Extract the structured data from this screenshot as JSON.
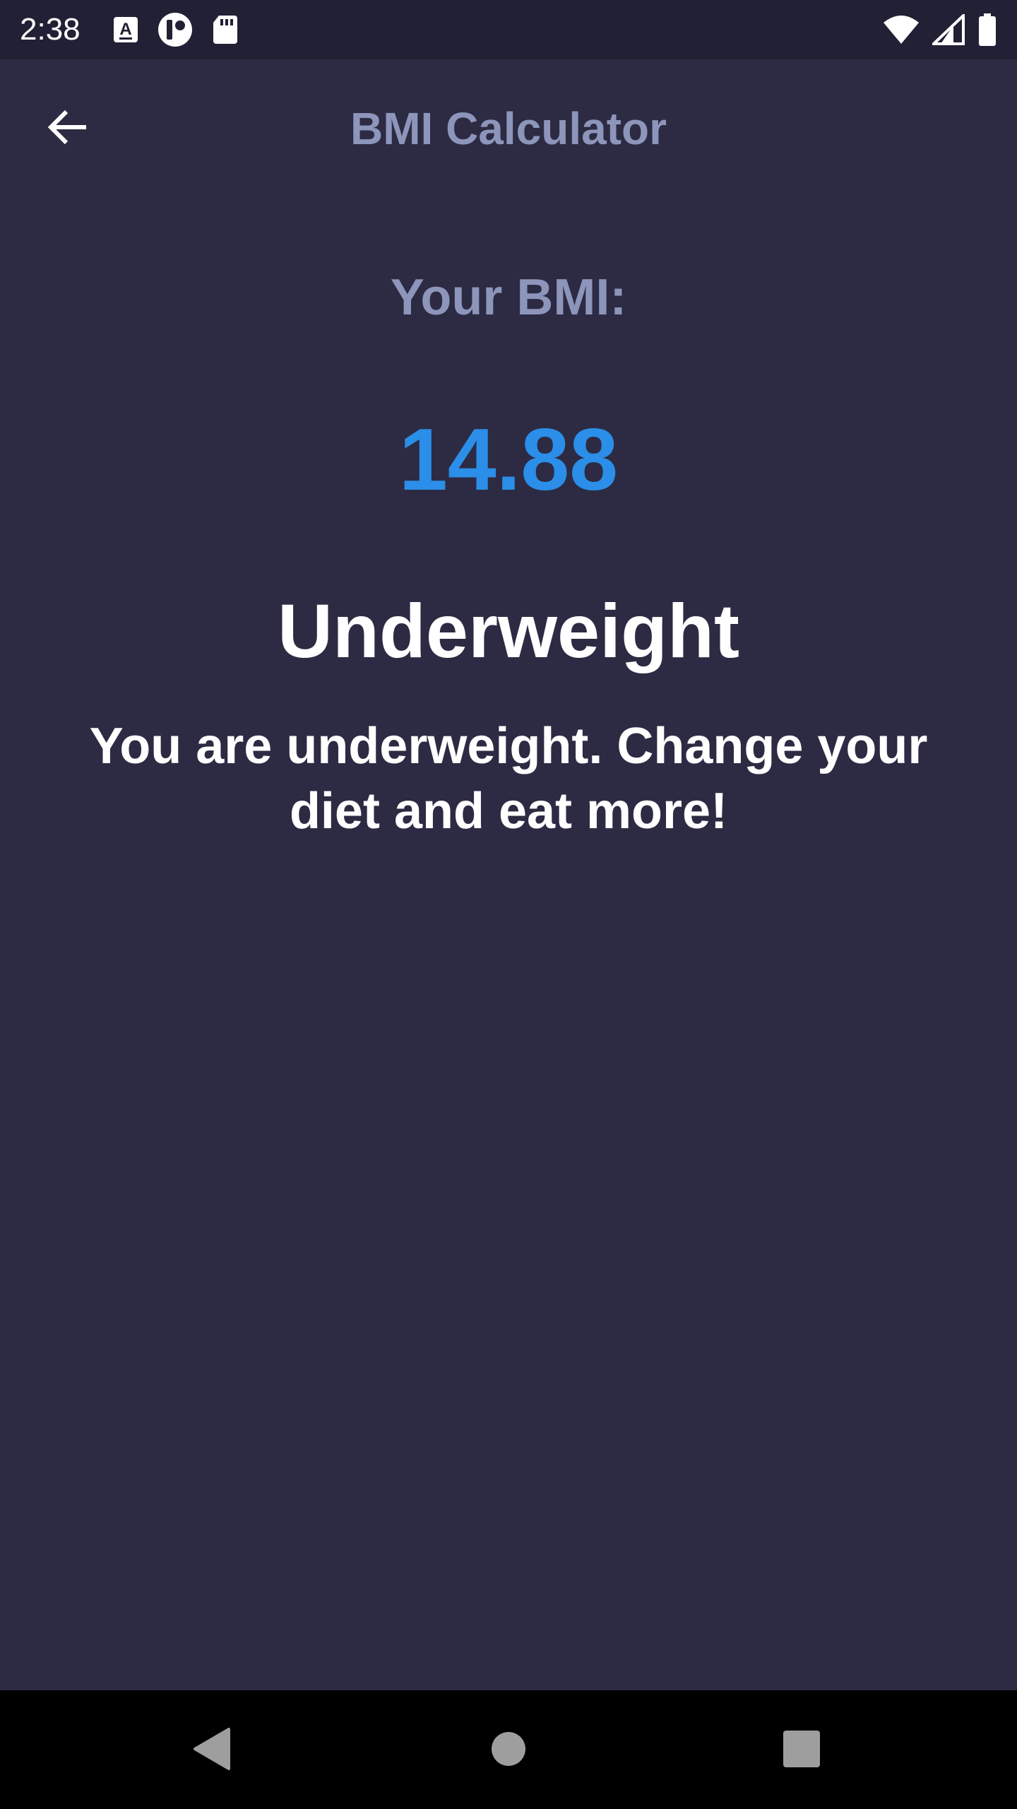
{
  "status_bar": {
    "time": "2:38",
    "left_icons": [
      "font-a-icon",
      "media-badge-icon",
      "sd-card-icon"
    ],
    "right_icons": [
      "wifi-icon",
      "cell-signal-icon",
      "battery-icon"
    ]
  },
  "app_bar": {
    "title": "BMI Calculator",
    "back_icon": "arrow-back-icon"
  },
  "result": {
    "label": "Your BMI:",
    "value": "14.88",
    "category": "Underweight",
    "advice": "You are underweight. Change your diet and eat more!"
  },
  "nav_bar": {
    "icons": [
      "nav-back-icon",
      "nav-home-icon",
      "nav-recents-icon"
    ]
  },
  "colors": {
    "background": "#2c2b43",
    "status_bar": "#222034",
    "title_muted": "#8d95bb",
    "accent_blue": "#2b8ee8",
    "text_white": "#ffffff",
    "nav_bar": "#000000",
    "nav_icons": "#9e9e9e"
  }
}
